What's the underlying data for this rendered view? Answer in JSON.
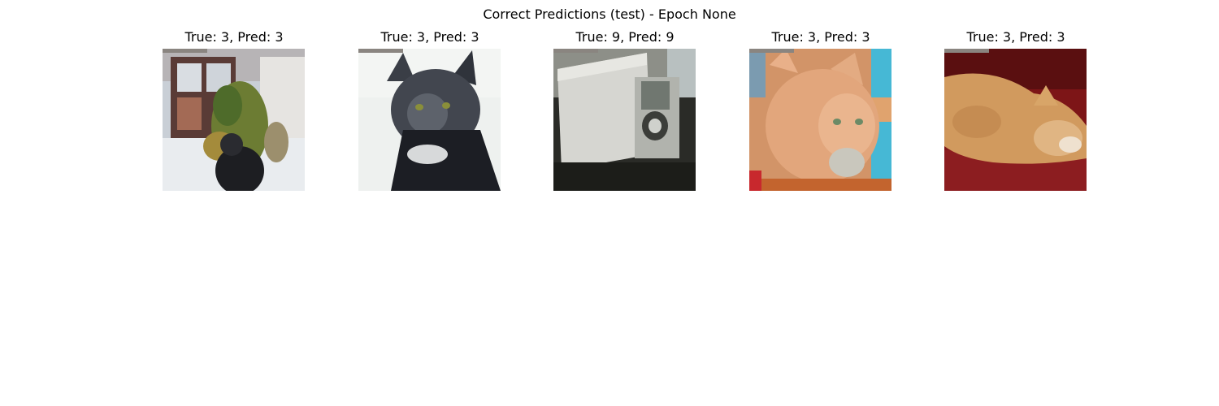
{
  "figure": {
    "title": "Correct Predictions (test) - Epoch None"
  },
  "panels": [
    {
      "title": "True: 3, Pred: 3",
      "image": "potted-plant-and-dark-object-photo"
    },
    {
      "title": "True: 3, Pred: 3",
      "image": "dark-gray-cat-photo"
    },
    {
      "title": "True: 9, Pred: 9",
      "image": "white-box-truck-photo"
    },
    {
      "title": "True: 3, Pred: 3",
      "image": "orange-fluffy-cat-photo"
    },
    {
      "title": "True: 3, Pred: 3",
      "image": "orange-cat-on-red-blanket-photo"
    }
  ]
}
